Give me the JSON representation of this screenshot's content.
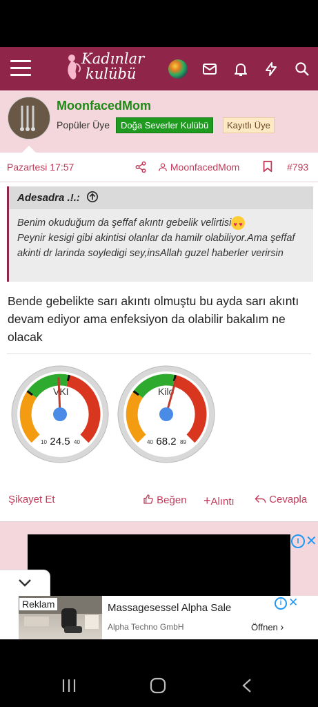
{
  "header": {
    "logo_text_line1": "Kadınlar",
    "logo_text_line2": "kulübü",
    "icons": [
      "menu-icon",
      "globe-icon",
      "mail-icon",
      "bell-icon",
      "lightning-icon",
      "search-icon"
    ]
  },
  "profile": {
    "username": "MoonfacedMom",
    "rank": "Popüler Üye",
    "badge_green": "Doğa Severler Kulübü",
    "badge_beige": "Kayıtlı Üye"
  },
  "post": {
    "date": "Pazartesi 17:57",
    "author": "MoonfacedMom",
    "number": "#793",
    "quote": {
      "author": "Adesadra .!.:",
      "text_line1": "Benim okuduğum da şeffaf akıntı gebelik velirtisi",
      "text_rest": "Peynir kesigi gibi akintisi olanlar da hamilr olabiliyor.Ama şeffaf akinti dr larinda soyledigi sey,insAllah guzel haberler verirsin"
    },
    "message": "Bende gebelikte sarı akıntı olmuştu bu ayda sarı akıntı devam ediyor ama enfeksiyon da olabilir bakalım ne olacak",
    "gauges": [
      {
        "label": "VKI",
        "min_label": "10",
        "max_label": "40",
        "value": "24.5"
      },
      {
        "label": "Kilo",
        "min_label": "40",
        "max_label": "89",
        "value": "68.2"
      }
    ],
    "actions": {
      "report": "Şikayet Et",
      "like": "Beğen",
      "quote": "Alıntı",
      "reply": "Cevapla"
    }
  },
  "ad": {
    "reklam_label": "Reklam",
    "title": "Massagesessel Alpha Sale",
    "subtitle": "Alpha Techno GmbH",
    "open_label": "Öffnen"
  },
  "colors": {
    "brand": "#8f2548",
    "accent": "#c03a5a",
    "username": "#1e8a15"
  }
}
